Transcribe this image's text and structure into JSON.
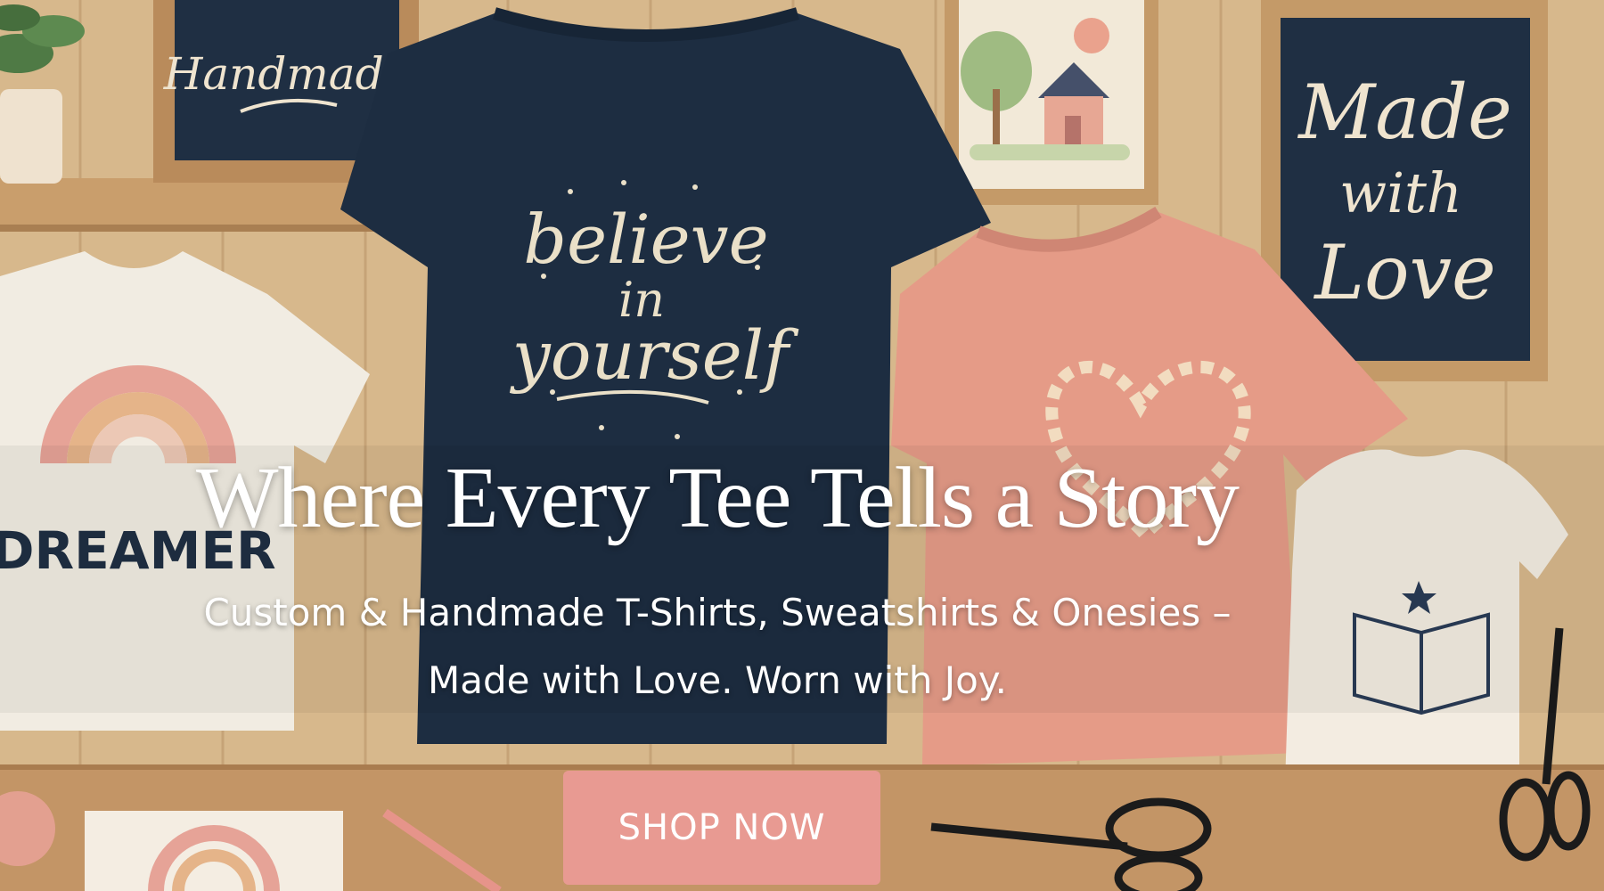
{
  "hero": {
    "headline": "Where Every Tee Tells a Story",
    "subheadline_line1": "Custom & Handmade T-Shirts, Sweatshirts & Onesies –",
    "subheadline_line2": "Made with Love. Worn with Joy.",
    "cta_label": "SHOP NOW"
  },
  "scene": {
    "frame_handmade_text": "Handmade",
    "frame_made_with_love_line1": "Made",
    "frame_made_with_love_line2": "with",
    "frame_made_with_love_line3": "Love",
    "navy_tee_line1": "believe",
    "navy_tee_line2": "in",
    "navy_tee_line3": "yourself",
    "white_tee_text": "DREAMER"
  },
  "colors": {
    "cta_background": "#e89a92",
    "navy": "#1f2f43",
    "pink": "#e8a08e",
    "cream": "#f3ece1",
    "wood": "#d9b98e"
  }
}
